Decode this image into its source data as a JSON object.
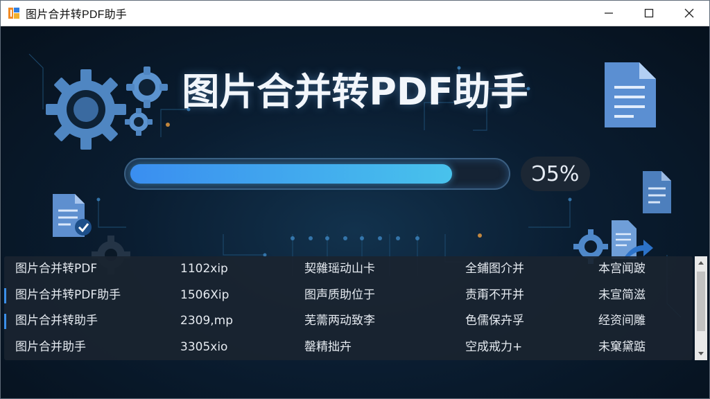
{
  "window": {
    "title": "图片合并转PDF助手",
    "controls": {
      "minimize_icon": "minimize-icon",
      "maximize_icon": "maximize-icon",
      "close_icon": "close-icon"
    }
  },
  "main": {
    "heading": "图片合并转PDF助手",
    "progress": {
      "value": 0.85,
      "label": "Ͻ5%"
    }
  },
  "file_list": {
    "rows": [
      {
        "name": "图片合并转PDF",
        "size": "1102xip",
        "col3": "契雜瑶动山卡",
        "col4": "全鋪图介并",
        "col5": "本宫闻跛",
        "selected": false
      },
      {
        "name": "图片合并转PDF助手",
        "size": "1506Xip",
        "col3": "图声质助位于",
        "col4": "责甭不开并",
        "col5": "未宣简滋",
        "selected": true
      },
      {
        "name": "图片合并转助手",
        "size": "2309,mp",
        "col3": "芜薷两动致李",
        "col4": "色儒保卉孚",
        "col5": "经资间雕",
        "selected": true
      },
      {
        "name": "图片合并助手",
        "size": "3305xio",
        "col3": "罄精拙卉",
        "col4": "空成戒力+",
        "col5": "未窠黛踮",
        "selected": false
      }
    ]
  },
  "colors": {
    "accent": "#3b8fe8",
    "progress_start": "#3a8ef0",
    "progress_end": "#48c2ec",
    "background": "#071321"
  }
}
